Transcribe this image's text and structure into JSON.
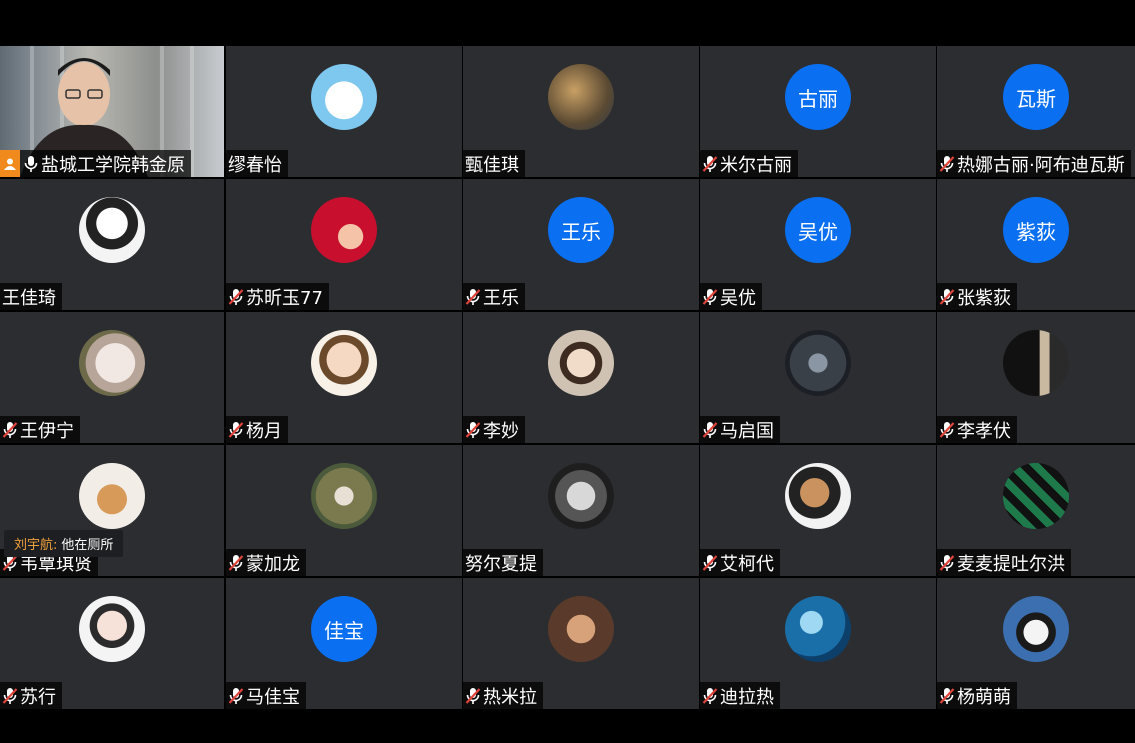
{
  "host": {
    "name": "盐城工学院韩金原"
  },
  "participants": [
    {
      "name": "盐城工学院韩金原",
      "muted": false,
      "video": true,
      "host": true
    },
    {
      "name": "缪春怡",
      "muted": false,
      "avatar": "image",
      "icon": "doraemon-avatar"
    },
    {
      "name": "甄佳琪",
      "muted": false,
      "avatar": "image",
      "icon": "deer-avatar"
    },
    {
      "name": "米尔古丽",
      "muted": true,
      "avatar": "text",
      "avatar_text": "古丽"
    },
    {
      "name": "热娜古丽·阿布迪瓦斯",
      "muted": true,
      "avatar": "text",
      "avatar_text": "瓦斯"
    },
    {
      "name": "王佳琦",
      "muted": false,
      "avatar": "image",
      "icon": "anime-girl-avatar"
    },
    {
      "name": "苏昕玉77",
      "muted": true,
      "avatar": "image",
      "icon": "mermaid-avatar"
    },
    {
      "name": "王乐",
      "muted": true,
      "avatar": "text",
      "avatar_text": "王乐"
    },
    {
      "name": "吴优",
      "muted": true,
      "avatar": "text",
      "avatar_text": "吴优"
    },
    {
      "name": "张紫荻",
      "muted": true,
      "avatar": "text",
      "avatar_text": "紫荻"
    },
    {
      "name": "王伊宁",
      "muted": true,
      "avatar": "image",
      "icon": "cat-avatar"
    },
    {
      "name": "杨月",
      "muted": true,
      "avatar": "image",
      "icon": "child-avatar"
    },
    {
      "name": "李妙",
      "muted": true,
      "avatar": "image",
      "icon": "woman-avatar"
    },
    {
      "name": "马启国",
      "muted": true,
      "avatar": "image",
      "icon": "knight-avatar"
    },
    {
      "name": "李孝伏",
      "muted": true,
      "avatar": "image",
      "icon": "silhouette-avatar"
    },
    {
      "name": "韦覃琪贤",
      "muted": true,
      "avatar": "image",
      "icon": "dog-avatar"
    },
    {
      "name": "蒙加龙",
      "muted": true,
      "avatar": "image",
      "icon": "plant-avatar"
    },
    {
      "name": "努尔夏提",
      "muted": false,
      "avatar": "image",
      "icon": "anime-boy-avatar"
    },
    {
      "name": "艾柯代",
      "muted": true,
      "avatar": "image",
      "icon": "girl-back-avatar"
    },
    {
      "name": "麦麦提吐尔洪",
      "muted": true,
      "avatar": "image",
      "icon": "demon-slayer-avatar"
    },
    {
      "name": "苏行",
      "muted": true,
      "avatar": "image",
      "icon": "portrait-avatar"
    },
    {
      "name": "马佳宝",
      "muted": true,
      "avatar": "text",
      "avatar_text": "佳宝"
    },
    {
      "name": "热米拉",
      "muted": true,
      "avatar": "image",
      "icon": "sunglasses-avatar"
    },
    {
      "name": "迪拉热",
      "muted": true,
      "avatar": "image",
      "icon": "water-avatar"
    },
    {
      "name": "杨萌萌",
      "muted": true,
      "avatar": "image",
      "icon": "cool-cat-avatar"
    }
  ],
  "chat": {
    "sender": "刘宇航:",
    "message": "他在厕所"
  },
  "colors": {
    "tile": "#2b2d30",
    "avatar_blue": "#0a6ff0",
    "host_badge": "#f08a1c",
    "muted_red": "#e0443a"
  }
}
